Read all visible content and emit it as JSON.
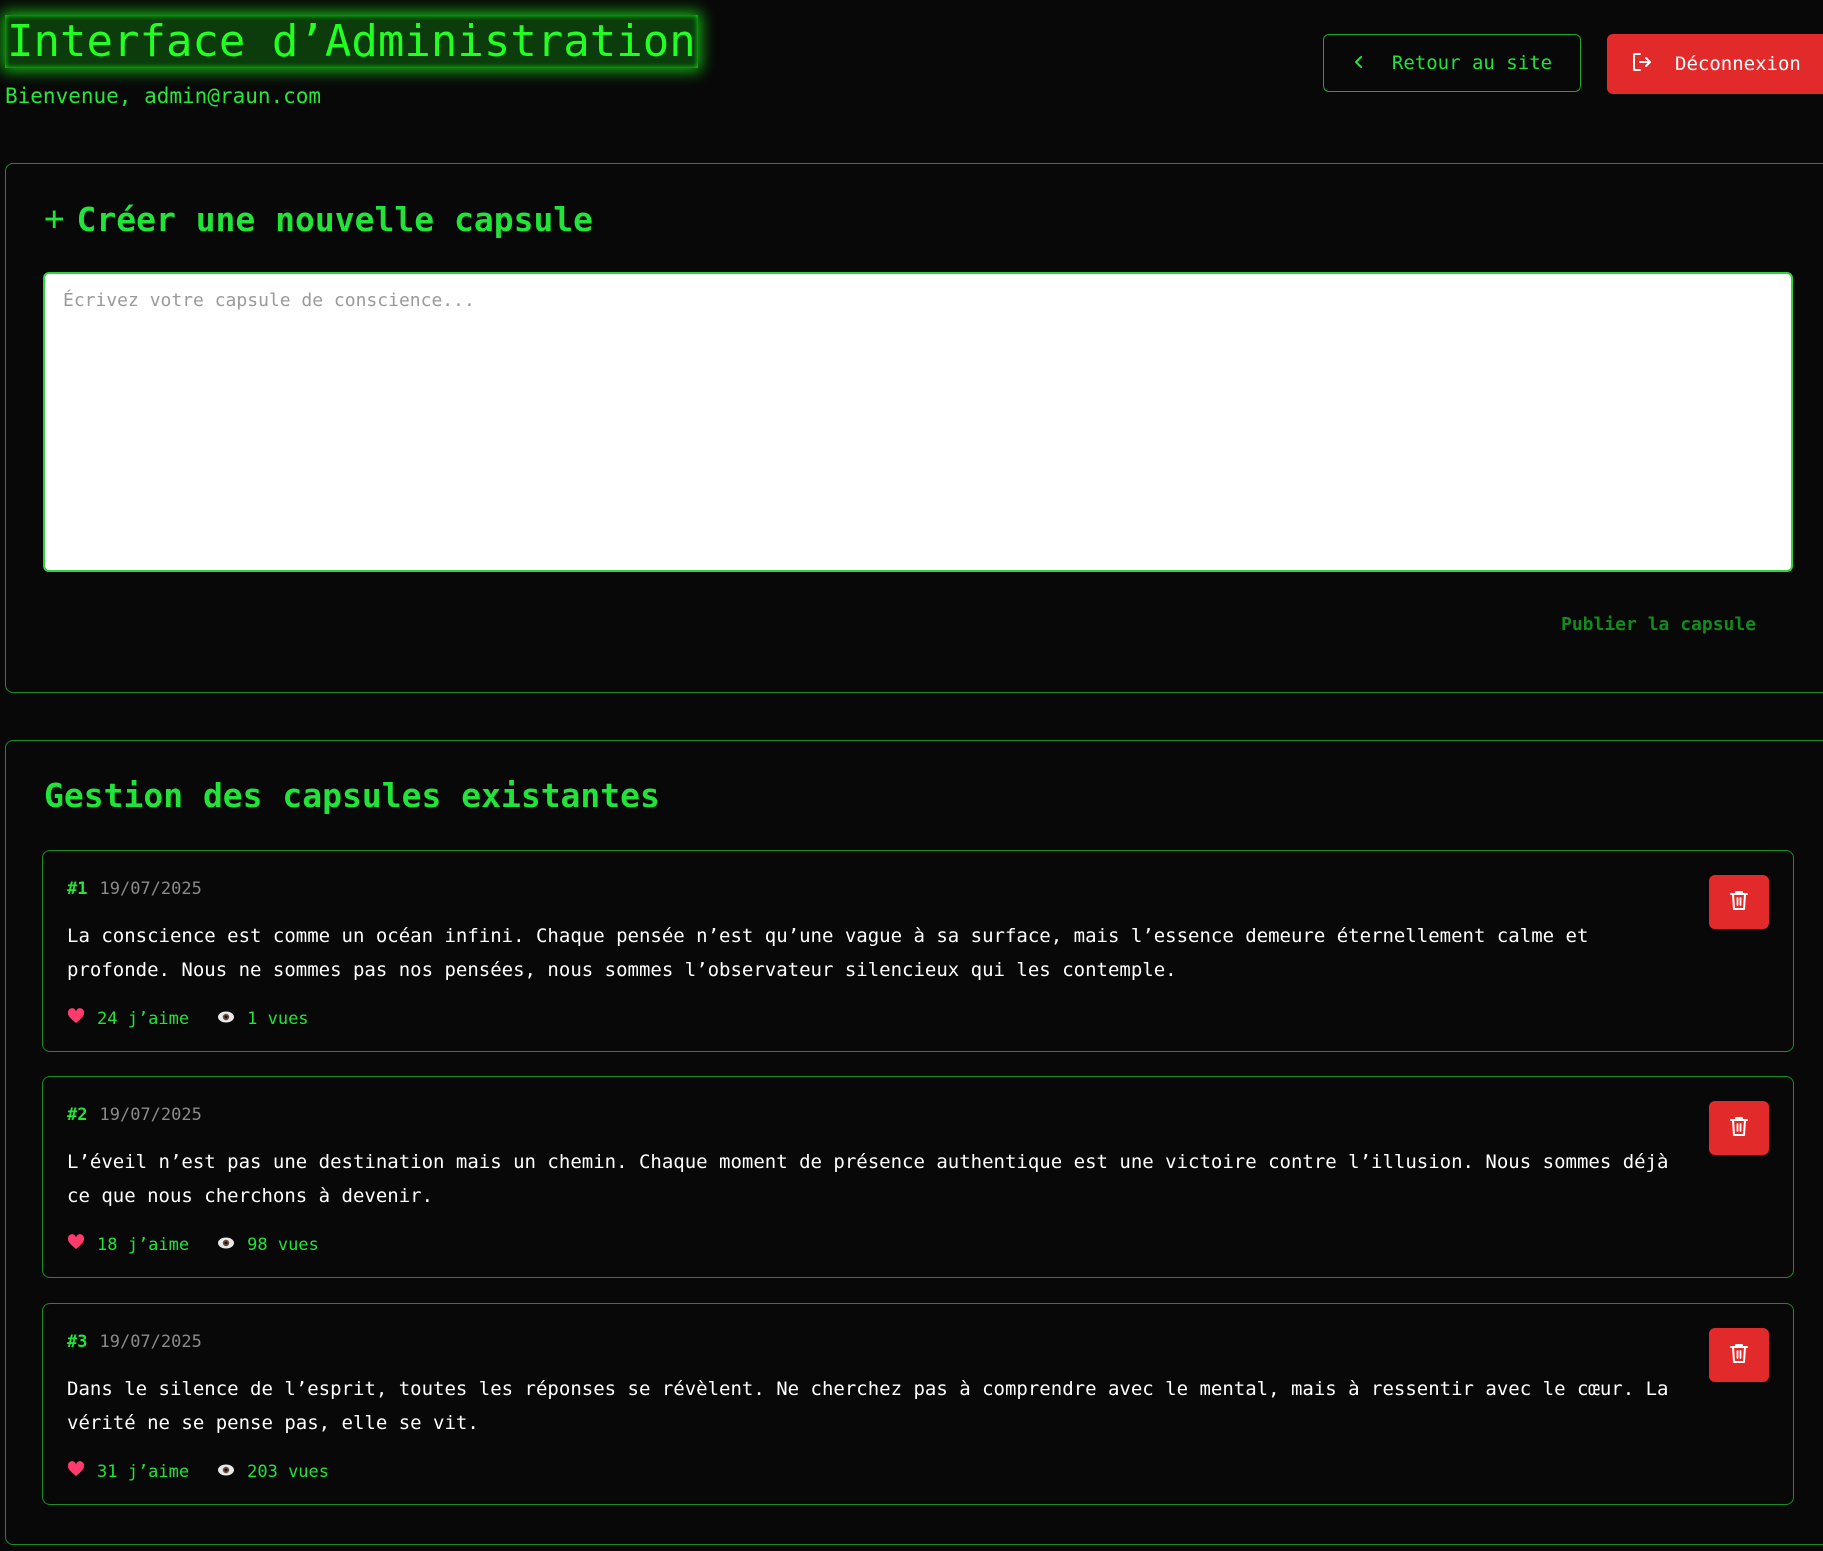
{
  "header": {
    "title": "Interface d’Administration",
    "welcome": "Bienvenue, admin@raun.com",
    "back_label": "Retour au site",
    "logout_label": "Déconnexion"
  },
  "create": {
    "title": "Créer une nouvelle capsule",
    "plus_glyph": "+",
    "placeholder": "Écrivez votre capsule de conscience...",
    "value": "",
    "publish_label": "Publier la capsule"
  },
  "manage": {
    "title": "Gestion des capsules existantes",
    "capsules": [
      {
        "num": "#1",
        "date": "19/07/2025",
        "text": "La conscience est comme un océan infini. Chaque pensée n’est qu’une vague à sa surface, mais l’essence demeure éternellement calme et profonde. Nous ne sommes pas nos pensées, nous sommes l’observateur silencieux qui les contemple.",
        "likes": "24 j’aime",
        "views": "1 vues"
      },
      {
        "num": "#2",
        "date": "19/07/2025",
        "text": "L’éveil n’est pas une destination mais un chemin. Chaque moment de présence authentique est une victoire contre l’illusion. Nous sommes déjà ce que nous cherchons à devenir.",
        "likes": "18 j’aime",
        "views": "98 vues"
      },
      {
        "num": "#3",
        "date": "19/07/2025",
        "text": "Dans le silence de l’esprit, toutes les réponses se révèlent. Ne cherchez pas à comprendre avec le mental, mais à ressentir avec le cœur. La vérité ne se pense pas, elle se vit.",
        "likes": "31 j’aime",
        "views": "203 vues"
      }
    ]
  },
  "icons": {
    "back": "chevron-left-icon",
    "logout": "logout-icon",
    "like": "heart-icon",
    "views": "eye-icon",
    "delete": "trash-icon"
  },
  "colors": {
    "accent": "#22e33a",
    "danger": "#e22a2a",
    "background": "#080808"
  }
}
